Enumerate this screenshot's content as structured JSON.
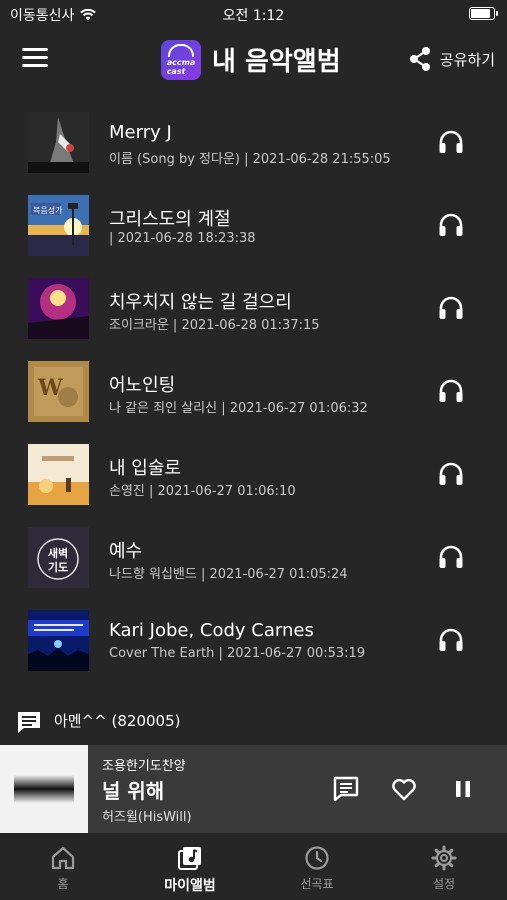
{
  "status_bar": {
    "carrier": "이동통신사",
    "time": "오전 1:12"
  },
  "header": {
    "title": "내 음악앨범",
    "share_label": "공유하기",
    "logo_text": "accma\ncast"
  },
  "items": [
    {
      "title": "Merry J",
      "subtitle": "이름 (Song by 정다운) | 2021-06-28 21:55:05"
    },
    {
      "title": "그리스도의 계절",
      "subtitle": " | 2021-06-28 18:23:38",
      "thumb_text": "복음성가"
    },
    {
      "title": "치우치지 않는 길 걸으리",
      "subtitle": "조이크라운 | 2021-06-28 01:37:15"
    },
    {
      "title": "어노인팅",
      "subtitle": "나 같은 죄인 살리신 | 2021-06-27 01:06:32",
      "thumb_text": "W"
    },
    {
      "title": "내 입술로",
      "subtitle": "손영진 | 2021-06-27 01:06:10"
    },
    {
      "title": "예수",
      "subtitle": "나드향 워십밴드 | 2021-06-27 01:05:24",
      "thumb_text": "새벽\n기도"
    },
    {
      "title": "Kari Jobe, Cody Carnes",
      "subtitle": "Cover The Earth | 2021-06-27 00:53:19"
    }
  ],
  "comment": {
    "text": "아멘^^ (820005)"
  },
  "player": {
    "album": "조용한기도찬양",
    "song": "널 위해",
    "artist": "허즈윌(HisWill)"
  },
  "tabs": [
    {
      "label": "홈",
      "icon": "home-icon"
    },
    {
      "label": "마이앨범",
      "icon": "album-icon"
    },
    {
      "label": "선곡표",
      "icon": "clock-icon"
    },
    {
      "label": "설정",
      "icon": "gear-icon"
    }
  ],
  "colors": {
    "background": "#262626",
    "player_bg": "#3a3a3a",
    "text": "#ffffff",
    "subtext": "#c8c8c8",
    "logo": "#6a44e0"
  }
}
